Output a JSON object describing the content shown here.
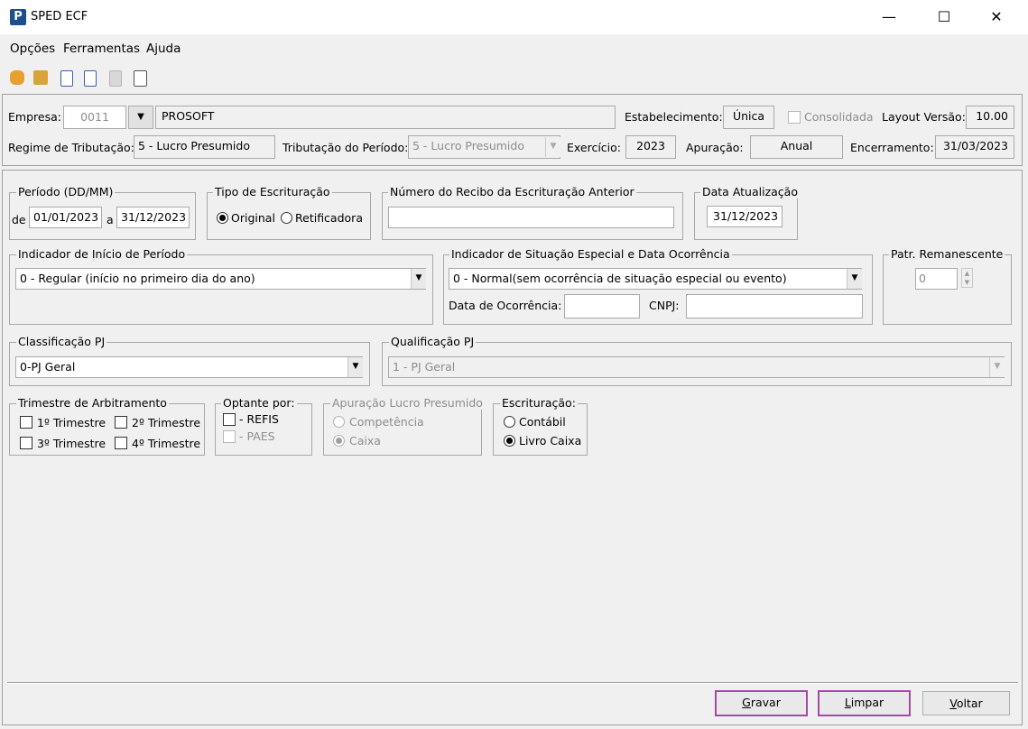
{
  "window": {
    "title": "SPED ECF",
    "app_icon": "P",
    "minimize": "—",
    "maximize": "☐",
    "close": "✕"
  },
  "menu": {
    "items": [
      "Opções",
      "Ferramentas",
      "Ajuda"
    ]
  },
  "toolbar": {
    "icons": [
      "hand-icon",
      "open-folder-icon",
      "document-icon",
      "document-search-icon",
      "disabled-document-icon",
      "copy-document-icon"
    ]
  },
  "header": {
    "empresa_label": "Empresa:",
    "empresa_code": "0011",
    "empresa_name": "PROSOFT",
    "estabelecimento_label": "Estabelecimento:",
    "estabelecimento_value": "Única",
    "consolidada_label": "Consolidada",
    "layout_label": "Layout Versão:",
    "layout_value": "10.00",
    "regime_label": "Regime de Tributação:",
    "regime_value": "5 - Lucro Presumido",
    "tributacao_label": "Tributação do Período:",
    "tributacao_value": "5 - Lucro Presumido",
    "exercicio_label": "Exercício:",
    "exercicio_value": "2023",
    "apuracao_label": "Apuração:",
    "apuracao_value": "Anual",
    "encerramento_label": "Encerramento:",
    "encerramento_value": "31/03/2023"
  },
  "periodo": {
    "legend": "Período (DD/MM)",
    "de_label": "de",
    "de_value": "01/01/2023",
    "a_label": "a",
    "a_value": "31/12/2023"
  },
  "tipo": {
    "legend": "Tipo de Escrituração",
    "original": "Original",
    "retificadora": "Retificadora",
    "selected": "original"
  },
  "recibo": {
    "legend": "Número do Recibo da Escrituração Anterior",
    "value": ""
  },
  "data_atualizacao": {
    "legend": "Data Atualização",
    "value": "31/12/2023"
  },
  "indicador_inicio": {
    "legend": "Indicador de Início de Período",
    "value": "0 - Regular (início no primeiro dia do ano)"
  },
  "situacao": {
    "legend": "Indicador de Situação Especial e Data Ocorrência",
    "value": "0 - Normal(sem ocorrência de situação especial ou evento)",
    "data_label": "Data de Ocorrência:",
    "data_value": "",
    "cnpj_label": "CNPJ:",
    "cnpj_value": ""
  },
  "patr": {
    "legend": "Patr. Remanescente",
    "value": "0"
  },
  "classificacao": {
    "legend": "Classificação PJ",
    "value": "0-PJ Geral"
  },
  "qualificacao": {
    "legend": "Qualificação PJ",
    "value": "1 - PJ Geral"
  },
  "trimestre": {
    "legend": "Trimestre de Arbitramento",
    "t1": "1º Trimestre",
    "t2": "2º Trimestre",
    "t3": "3º Trimestre",
    "t4": "4º Trimestre"
  },
  "optante": {
    "legend": "Optante por:",
    "refis": "- REFIS",
    "paes": "- PAES"
  },
  "apuracao_lp": {
    "legend": "Apuração Lucro Presumido",
    "competencia": "Competência",
    "caixa": "Caixa",
    "selected": "caixa"
  },
  "escrituracao": {
    "legend": "Escrituração:",
    "contabil": "Contábil",
    "livro_caixa": "Livro Caixa",
    "selected": "livro_caixa"
  },
  "buttons": {
    "gravar_u": "G",
    "gravar_rest": "ravar",
    "limpar_u": "L",
    "limpar_rest": "impar",
    "voltar_u": "V",
    "voltar_rest": "oltar"
  },
  "colors": {
    "highlight": "#a14aa6",
    "app_icon_bg": "#1d4f8f"
  }
}
